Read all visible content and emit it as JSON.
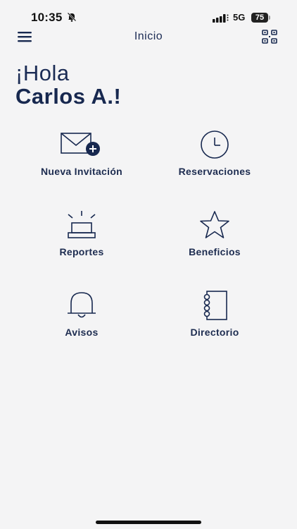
{
  "status_bar": {
    "time": "10:35",
    "network": "5G",
    "battery": "75"
  },
  "nav": {
    "title": "Inicio",
    "menu_icon": "hamburger-menu-icon",
    "qr_icon": "qr-code-icon"
  },
  "greeting": {
    "line1": "¡Hola",
    "line2": "Carlos A.!"
  },
  "menu": {
    "items": [
      {
        "label": "Nueva Invitación",
        "icon": "envelope-plus-icon"
      },
      {
        "label": "Reservaciones",
        "icon": "clock-icon"
      },
      {
        "label": "Reportes",
        "icon": "alarm-light-icon"
      },
      {
        "label": "Beneficios",
        "icon": "star-icon"
      },
      {
        "label": "Avisos",
        "icon": "bell-icon"
      },
      {
        "label": "Directorio",
        "icon": "notebook-icon"
      }
    ]
  },
  "colors": {
    "primary": "#17284f",
    "background": "#f4f4f5"
  }
}
